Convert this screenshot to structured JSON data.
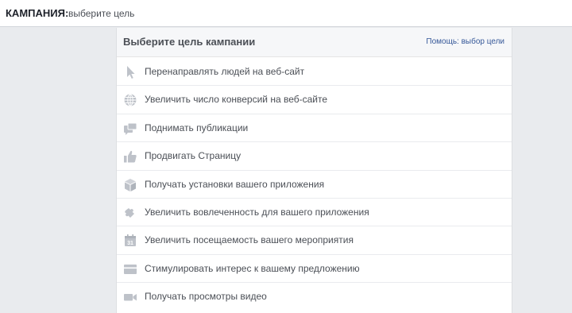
{
  "header": {
    "campaign_label": "КАМПАНИЯ:",
    "campaign_hint": "выберите цель"
  },
  "panel": {
    "title": "Выберите цель кампании",
    "help_link": "Помощь: выбор цели"
  },
  "objectives": [
    {
      "label": "Перенаправлять людей на веб-сайт",
      "icon": "cursor-icon"
    },
    {
      "label": "Увеличить число конверсий на веб-сайте",
      "icon": "globe-icon"
    },
    {
      "label": "Поднимать публикации",
      "icon": "posts-icon"
    },
    {
      "label": "Продвигать Страницу",
      "icon": "thumbs-up-icon"
    },
    {
      "label": "Получать установки вашего приложения",
      "icon": "box-icon"
    },
    {
      "label": "Увеличить вовлеченность для вашего приложения",
      "icon": "puzzle-icon"
    },
    {
      "label": "Увеличить посещаемость вашего мероприятия",
      "icon": "calendar-icon"
    },
    {
      "label": "Стимулировать интерес к вашему предложению",
      "icon": "offer-icon"
    },
    {
      "label": "Получать просмотры видео",
      "icon": "video-camera-icon"
    }
  ],
  "colors": {
    "icon": "#bec2c9",
    "text": "#4b4f56",
    "link": "#365899",
    "background": "#e9ebee"
  }
}
